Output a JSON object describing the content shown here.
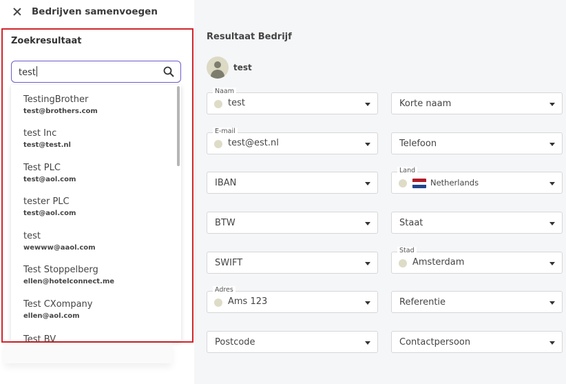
{
  "header": {
    "title": "Bedrijven samenvoegen"
  },
  "search_panel": {
    "title": "Zoekresultaat",
    "search_value": "test",
    "results": [
      {
        "name": "TestingBrother",
        "email": "test@brothers.com"
      },
      {
        "name": "test Inc",
        "email": "test@test.nl"
      },
      {
        "name": "Test PLC",
        "email": "test@aol.com"
      },
      {
        "name": "tester PLC",
        "email": "test@aol.com"
      },
      {
        "name": "test",
        "email": "wewww@aaol.com"
      },
      {
        "name": "Test Stoppelberg",
        "email": "ellen@hotelconnect.me"
      },
      {
        "name": "Test CXompany",
        "email": "ellen@aol.com"
      },
      {
        "name": "Test BV",
        "email": ""
      }
    ]
  },
  "result_panel": {
    "title": "Resultaat Bedrijf",
    "company_name": "test",
    "fields": {
      "naam": {
        "label": "Naam",
        "value": "test"
      },
      "korte_naam": {
        "placeholder": "Korte naam"
      },
      "email": {
        "label": "E-mail",
        "value": "test@est.nl"
      },
      "telefoon": {
        "placeholder": "Telefoon"
      },
      "iban": {
        "placeholder": "IBAN"
      },
      "land": {
        "label": "Land",
        "value": "Netherlands"
      },
      "btw": {
        "placeholder": "BTW"
      },
      "staat": {
        "placeholder": "Staat"
      },
      "swift": {
        "placeholder": "SWIFT"
      },
      "stad": {
        "label": "Stad",
        "value": "Amsterdam"
      },
      "adres": {
        "label": "Adres",
        "value": "Ams 123"
      },
      "referentie": {
        "placeholder": "Referentie"
      },
      "postcode": {
        "placeholder": "Postcode"
      },
      "contactpersoon": {
        "placeholder": "Contactpersoon"
      }
    }
  },
  "colors": {
    "highlight_border": "#d0262c",
    "search_border": "#6c5cc9",
    "flag_red": "#ae1c28",
    "flag_white": "#ffffff",
    "flag_blue": "#21468b"
  }
}
